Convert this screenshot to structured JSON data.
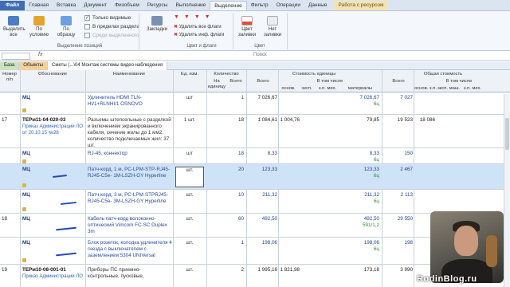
{
  "menu": {
    "tabs": [
      "Файл",
      "Главная",
      "Вставка",
      "Документ",
      "Физобъем",
      "Ресурсы",
      "Выполнение",
      "Выделение",
      "Фильтр",
      "Операции",
      "Данные",
      "Работа с ресурсом"
    ]
  },
  "ribbon": {
    "select_all": "Выделить все",
    "by_condition": "По условию",
    "by_sample": "По образцу",
    "only_visible": "Только видимые",
    "within_section": "В пределах раздела",
    "among_selected": "Среди выделенного",
    "group_selection": "Выделение позиций",
    "bookmarks": "Закладки",
    "remove_all_flags": "Удалить все флаги",
    "remove_other_flags": "Удалить инф. флаги",
    "group_colors": "Цвет и флаги",
    "fill_color": "Цвет заливки",
    "no_fill": "Нет заливки",
    "group_color": "Цвет"
  },
  "search": {
    "fx": "fx",
    "placeholder": "Поиск"
  },
  "doc_tabs": [
    "База",
    "Объекты",
    "Сметы (...\\04 Монтаж системы видео наблюдения"
  ],
  "header": {
    "num": "Номер п/п",
    "basis": "Обоснование",
    "name": "Наименование",
    "unit": "Ед. изм.",
    "qty": "Количество",
    "per_unit": "На единицу",
    "total": "Всего",
    "unit_cost": "Стоимость единицы",
    "incl": "В том числе",
    "total_cost": "Общая стоимость",
    "basic": "основ.",
    "mach": "эксп.",
    "wage": "з.п. мех.",
    "materials": "материалы",
    "basic_wage": "основ. з.п.",
    "mach2": "эксп. маш.",
    "wage2": "з.п. мех."
  },
  "rows": [
    {
      "num": "",
      "basis": "МЦ",
      "order": "",
      "name": "Удлинитель HDMI TLN-HI/1+RLNHI/1 OSNOVO",
      "unit": "шт",
      "per_unit": "",
      "total": "1",
      "cost": "7 026,67",
      "basic": "",
      "mach": "",
      "wage": "",
      "mat": "7 026,67",
      "mat2": "6ц",
      "tcost": "7 027",
      "tbasic": "",
      "tmach": ""
    },
    {
      "num": "17",
      "basis": "ТЕРм11-04-020-03",
      "order": "Приказ Администрации ЛО от 20.10.15 №28",
      "name": "Разъемы штепсельные с разделкой и включением экранированного кабеля, сечение жилы до 1 мм2, количество подключаемых жил: 37 шт.",
      "unit": "1 шт.",
      "per_unit": "",
      "total": "18",
      "cost": "1 084,61",
      "basic": "1 004,76",
      "mach": "",
      "wage": "",
      "mat": "79,85",
      "mat2": "",
      "tcost": "19 523",
      "tbasic": "18 086",
      "tmach": ""
    },
    {
      "num": "",
      "basis": "МЦ",
      "order": "",
      "name": "RJ-45, коннектор",
      "unit": "шт",
      "per_unit": "",
      "total": "18",
      "cost": "8,33",
      "basic": "",
      "mach": "",
      "wage": "",
      "mat": "8,33",
      "mat2": "6ц",
      "tcost": "150",
      "tbasic": "",
      "tmach": ""
    },
    {
      "num": "",
      "basis": "МЦ",
      "order": "",
      "name": "Патч-корд, 1 м, PC-LPM-STP-RJ45-RJ45-C5e- 1M-LSZH-GY Hyperline",
      "unit": "шт.",
      "per_unit": "",
      "total": "20",
      "cost": "123,33",
      "basic": "",
      "mach": "",
      "wage": "",
      "mat": "123,33",
      "mat2": "6ц",
      "tcost": "2 467",
      "tbasic": "",
      "tmach": ""
    },
    {
      "num": "",
      "basis": "МЦ",
      "order": "",
      "name": "Патч-корд, 3 м, PC-LPM-STPRJ45-RJ45-C5e- 3M-LSZH-GY Hyperline",
      "unit": "шт.",
      "per_unit": "",
      "total": "10",
      "cost": "211,32",
      "basic": "",
      "mach": "",
      "wage": "",
      "mat": "211,32",
      "mat2": "6ц",
      "tcost": "2 113",
      "tbasic": "",
      "tmach": ""
    },
    {
      "num": "18",
      "basis": "МЦ",
      "order": "",
      "name": "Кабель патч-корд волоконно-оптический Vimcom FC-SC Duplex 3m",
      "unit": "шт.",
      "per_unit": "",
      "total": "60",
      "cost": "492,50",
      "basic": "",
      "mach": "",
      "wage": "",
      "mat": "492,50",
      "mat2": "591/1,2",
      "tcost": "29 550",
      "tbasic": "",
      "tmach": ""
    },
    {
      "num": "",
      "basis": "МЦ",
      "order": "",
      "name": "Блок розеток, колодка удлинителя 4 гнезда с выключателем с заземлением 5304 UNIVersal",
      "unit": "шт.",
      "per_unit": "",
      "total": "1",
      "cost": "198,06",
      "basic": "",
      "mach": "",
      "wage": "",
      "mat": "198,06",
      "mat2": "6ц",
      "tcost": "198",
      "tbasic": "",
      "tmach": ""
    },
    {
      "num": "19",
      "basis": "ТЕРм10-08-001-01",
      "order": "Приказ Администрации ЛО",
      "name": "Приборы ПС приемно-контрольные, пусковые,",
      "unit": "шт.",
      "per_unit": "",
      "total": "2",
      "cost": "1 995,16",
      "basic": "1 821,98",
      "mach": "",
      "wage": "",
      "mat": "173,18",
      "mat2": "",
      "tcost": "3 990",
      "tbasic": "",
      "tmach": ""
    }
  ],
  "watermark": "RodinBlog.ru"
}
